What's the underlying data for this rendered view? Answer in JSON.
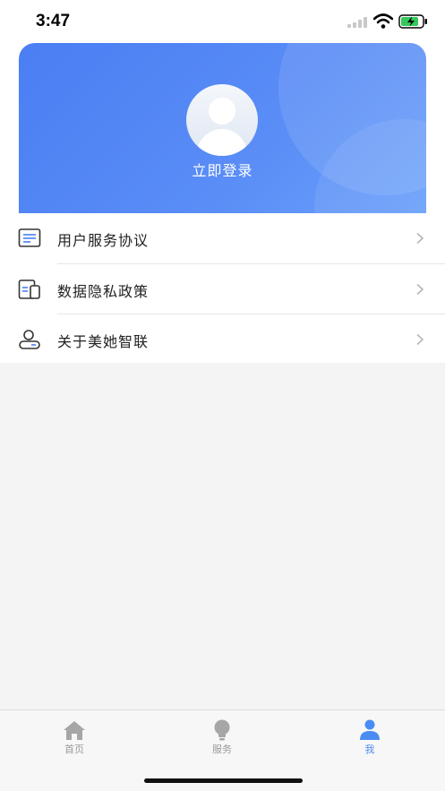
{
  "status_bar": {
    "time": "3:47",
    "icons": [
      "signal-icon",
      "wifi-icon",
      "battery-charging-icon"
    ]
  },
  "header": {
    "avatar_icon": "user-avatar-icon",
    "login_label": "立即登录"
  },
  "menu": {
    "items": [
      {
        "label": "用户服务协议",
        "icon": "document-icon"
      },
      {
        "label": "数据隐私政策",
        "icon": "privacy-icon"
      },
      {
        "label": "关于美她智联",
        "icon": "user-info-icon"
      }
    ],
    "arrow_icon": "chevron-right-icon"
  },
  "tab_bar": {
    "tabs": [
      {
        "label": "首页",
        "icon": "home-icon",
        "active": false
      },
      {
        "label": "服务",
        "icon": "lightbulb-icon",
        "active": false
      },
      {
        "label": "我",
        "icon": "user-icon",
        "active": true
      }
    ]
  },
  "colors": {
    "accent": "#4a7ef3",
    "tab_inactive": "#9a9a9a",
    "tab_active": "#4a8cf3",
    "background": "#f4f4f5"
  }
}
